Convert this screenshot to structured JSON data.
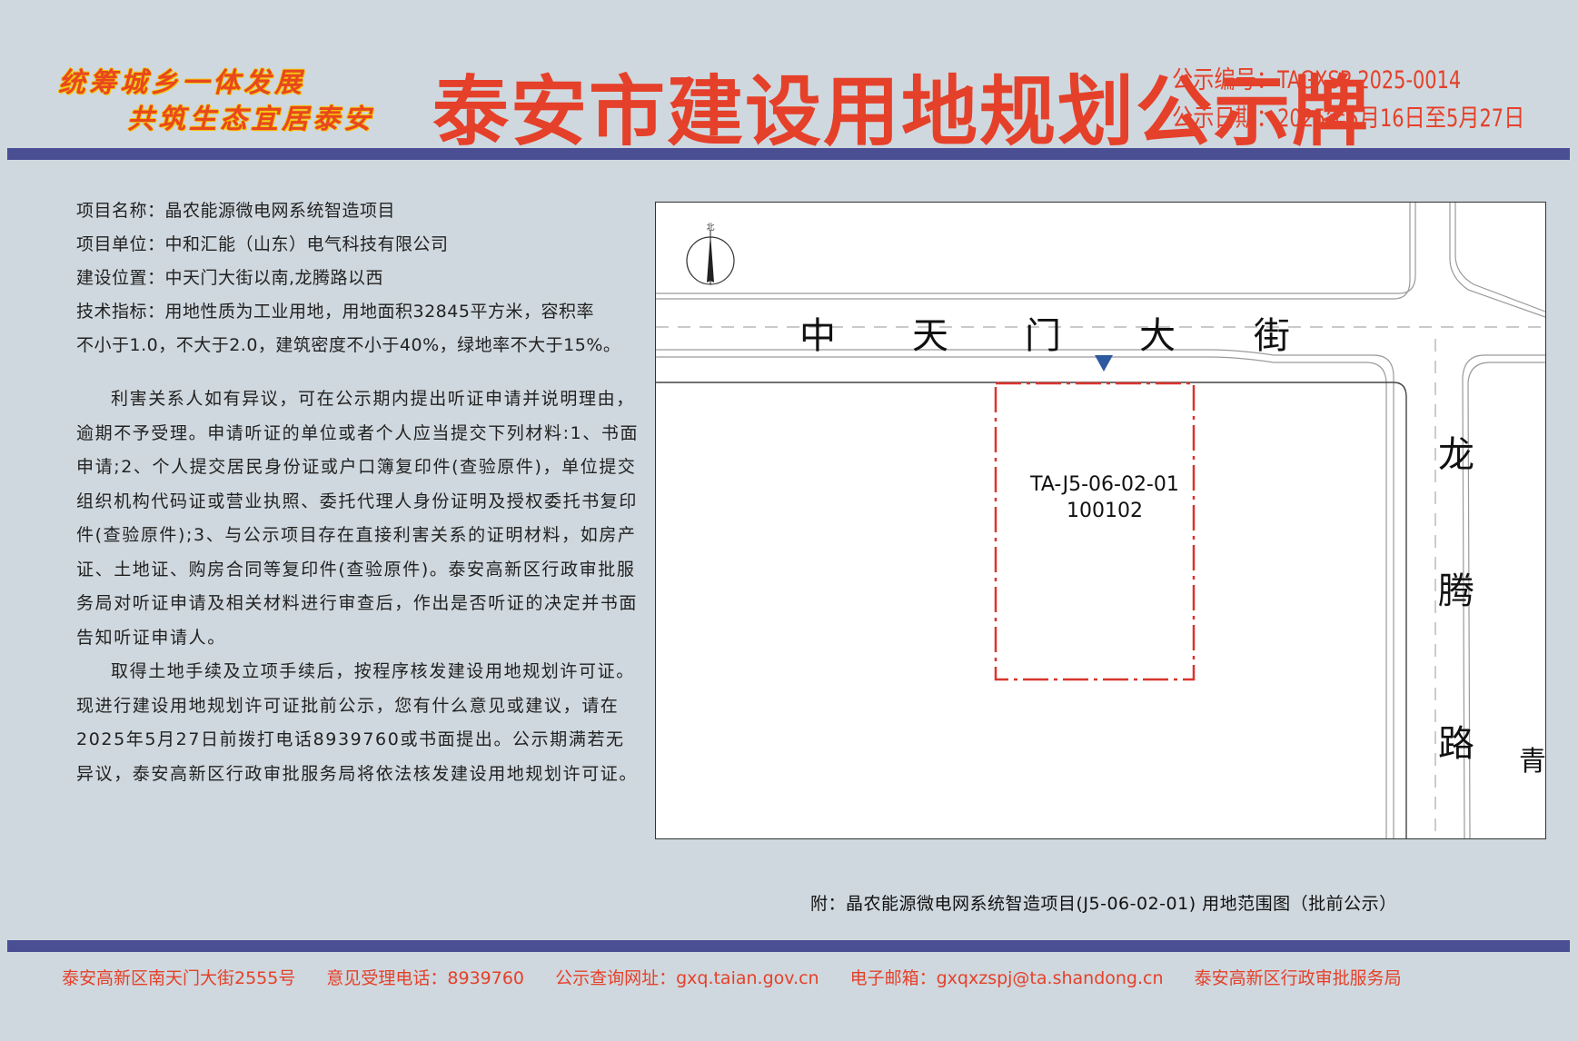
{
  "header": {
    "slogan_line1": "统筹城乡一体发展",
    "slogan_line2": "共筑生态宜居泰安",
    "title": "泰安市建设用地规划公示牌",
    "notice_number": "公示编号：TAGXSP-2025-0014",
    "notice_date": "公示日期：2025年5月16日至5月27日"
  },
  "info": {
    "project_name": "项目名称：晶农能源微电网系统智造项目",
    "project_unit": "项目单位：中和汇能（山东）电气科技有限公司",
    "location": "建设位置：中天门大街以南,龙腾路以西",
    "tech_line1": "技术指标：用地性质为工业用地，用地面积32845平方米，容积率",
    "tech_line2": "不小于1.0，不大于2.0，建筑密度不小于40%，绿地率不大于15%。",
    "para1": "利害关系人如有异议，可在公示期内提出听证申请并说明理由，逾期不予受理。申请听证的单位或者个人应当提交下列材料:1、书面申请;2、个人提交居民身份证或户口簿复印件(查验原件)，单位提交组织机构代码证或营业执照、委托代理人身份证明及授权委托书复印件(查验原件);3、与公示项目存在直接利害关系的证明材料，如房产证、土地证、购房合同等复印件(查验原件)。泰安高新区行政审批服务局对听证申请及相关材料进行审查后，作出是否听证的决定并书面告知听证申请人。",
    "para2": "取得土地手续及立项手续后，按程序核发建设用地规划许可证。现进行建设用地规划许可证批前公示，您有什么意见或建议，请在2025年5月27日前拨打电话8939760或书面提出。公示期满若无异议，泰安高新区行政审批服务局将依法核发建设用地规划许可证。"
  },
  "map": {
    "north_label": "北",
    "street_chars": [
      "中",
      "天",
      "门",
      "大",
      "街"
    ],
    "road_chars": [
      "龙",
      "腾",
      "路"
    ],
    "parcel_code": "TA-J5-06-02-01",
    "parcel_id": "100102",
    "edge_char": "青",
    "parcel_color": "#d9352e",
    "marker_color": "#2d5a9e"
  },
  "caption": "附：晶农能源微电网系统智造项目(J5-06-02-01) 用地范围图（批前公示）",
  "footer": {
    "address": "泰安高新区南天门大街2555号",
    "phone": "意见受理电话：8939760",
    "website": "公示查询网址：gxq.taian.gov.cn",
    "email": "电子邮箱：gxqxzspj@ta.shandong.cn",
    "office": "泰安高新区行政审批服务局"
  },
  "colors": {
    "background": "#cfd8de",
    "accent_red": "#e5402a",
    "bar_blue": "#4a4f93"
  }
}
